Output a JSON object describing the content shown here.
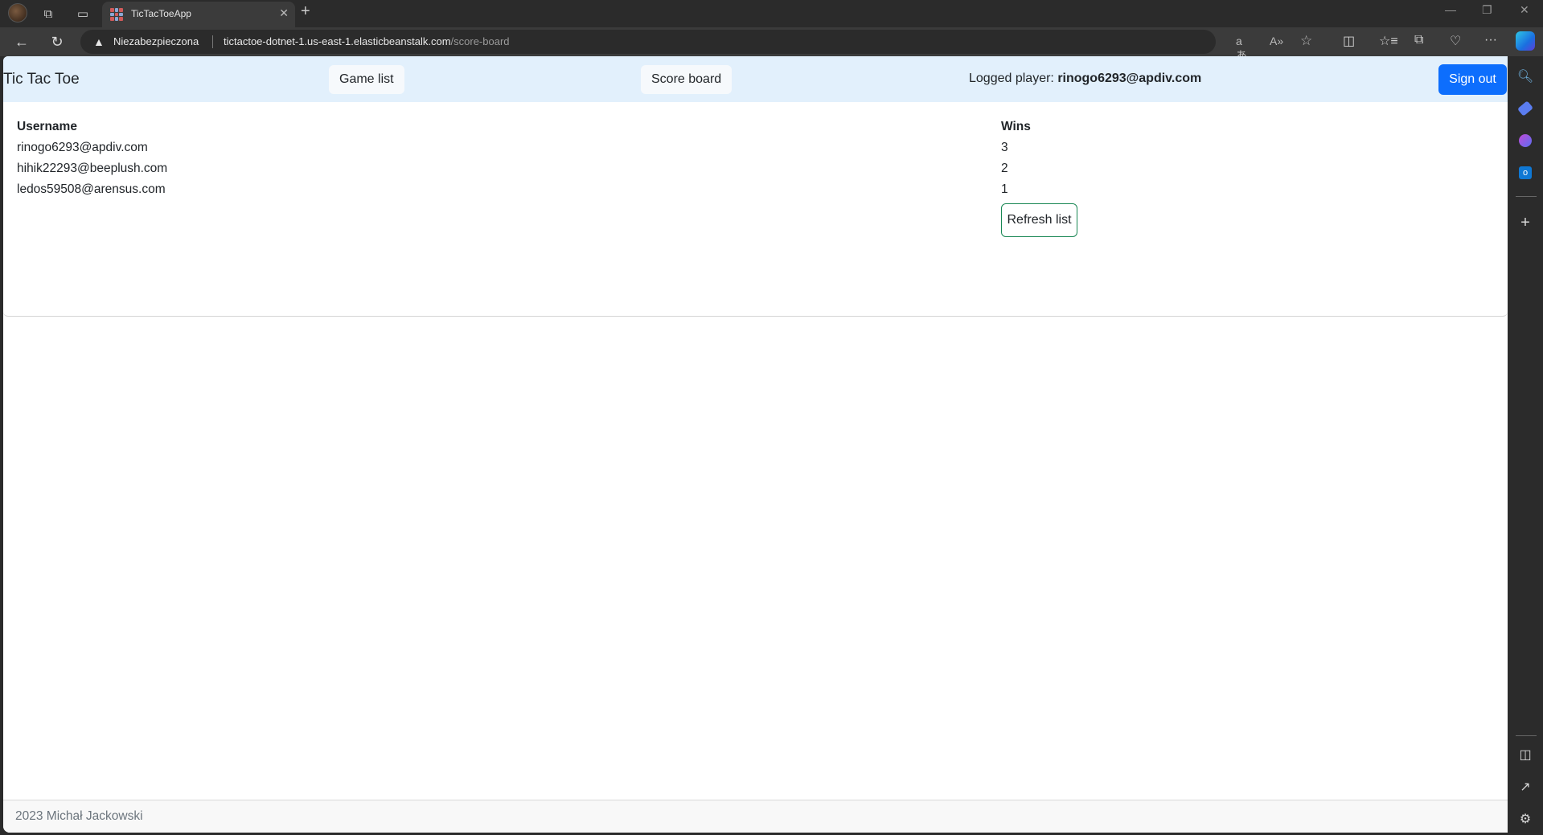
{
  "browser": {
    "tab": {
      "title": "TicTacToeApp"
    },
    "address": {
      "security_label": "Niezabezpieczona",
      "url_host": "tictactoe-dotnet-1.us-east-1.elasticbeanstalk.com",
      "url_path": "/score-board"
    },
    "icons": {
      "new_tab": "+",
      "minimize": "—",
      "restore": "❐",
      "close": "✕",
      "back": "←",
      "reload": "↻",
      "warning": "▲",
      "translate": "aあ",
      "read_aloud": "A»",
      "favorite": "☆",
      "split": "◫",
      "favorites": "☆≡",
      "collections": "⧉",
      "health": "♡",
      "more": "···"
    }
  },
  "navbar": {
    "brand": "Tic Tac Toe",
    "links": [
      {
        "label": "Game list"
      },
      {
        "label": "Score board"
      }
    ],
    "logged_label": "Logged player: ",
    "logged_user": "rinogo6293@apdiv.com",
    "signout_label": "Sign out"
  },
  "scoreboard": {
    "columns": [
      "Username",
      "Wins"
    ],
    "rows": [
      {
        "username": "rinogo6293@apdiv.com",
        "wins": "3"
      },
      {
        "username": "hihik22293@beeplush.com",
        "wins": "2"
      },
      {
        "username": "ledos59508@arensus.com",
        "wins": "1"
      }
    ],
    "refresh_label": "Refresh list"
  },
  "footer": {
    "text": "2023 Michał Jackowski"
  },
  "colors": {
    "navbar_bg": "#e2f0fc",
    "primary": "#0d6efd",
    "success_border": "#198754"
  }
}
